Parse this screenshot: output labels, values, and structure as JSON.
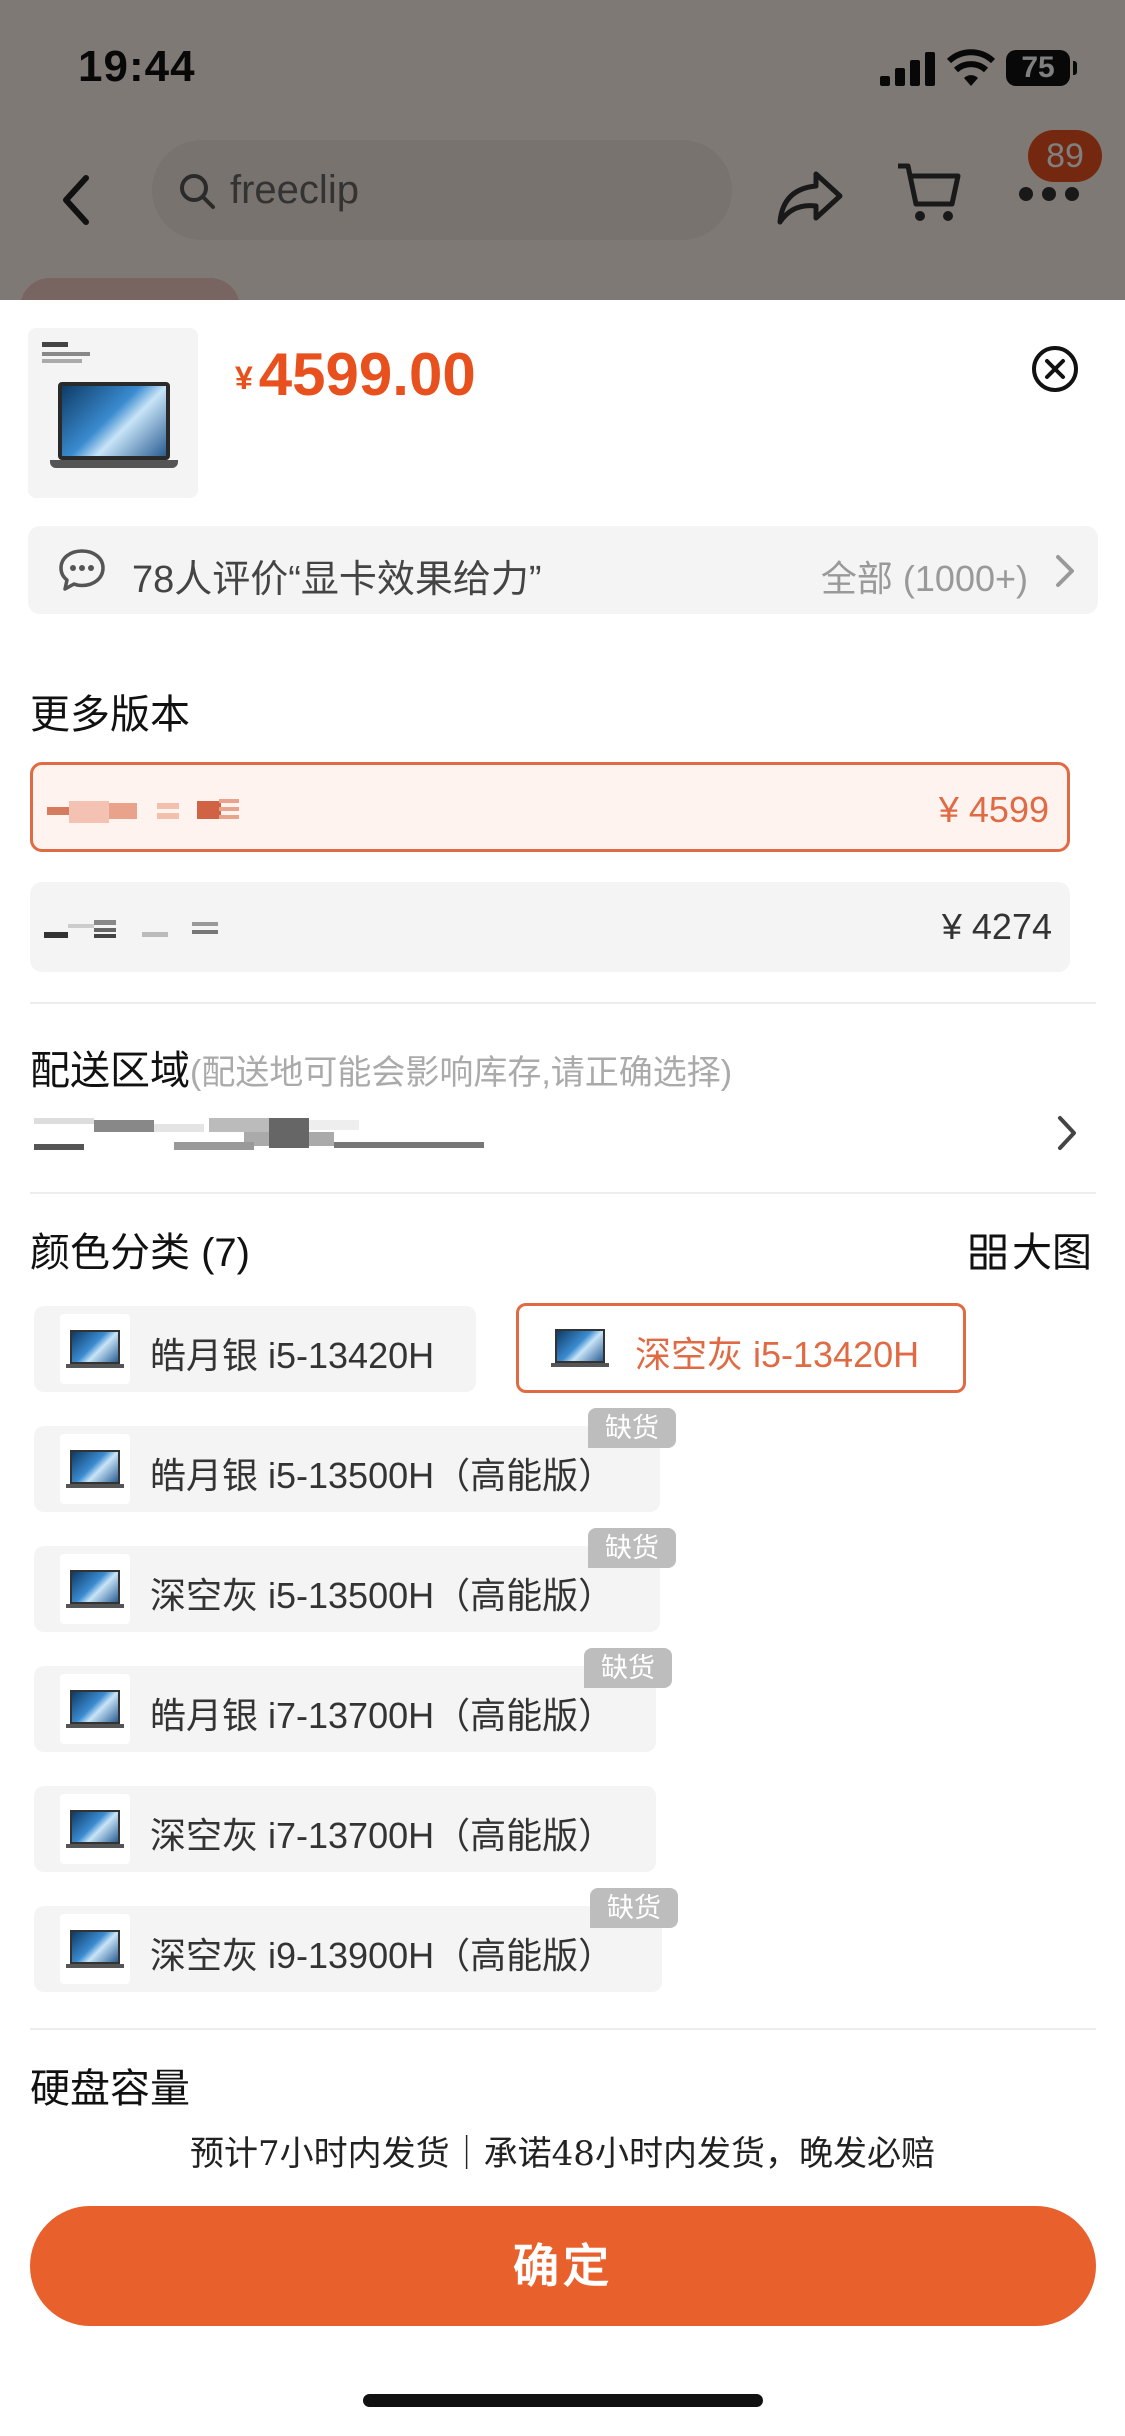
{
  "status_bar": {
    "time": "19:44",
    "battery": "75"
  },
  "nav": {
    "search_text": "freeclip",
    "cart_badge": "89"
  },
  "product": {
    "currency": "¥",
    "price": "4599.00"
  },
  "review": {
    "summary": "78人评价“显卡效果给力”",
    "all_label": "全部 (1000+)"
  },
  "versions": {
    "title": "更多版本",
    "items": [
      {
        "price": "¥ 4599",
        "selected": true
      },
      {
        "price": "¥ 4274",
        "selected": false
      }
    ]
  },
  "delivery": {
    "title": "配送区域",
    "note": "(配送地可能会影响库存,请正确选择)"
  },
  "colors": {
    "title": "颜色分类 (7)",
    "big_image_label": "大图",
    "out_of_stock_label": "缺货",
    "items": [
      {
        "label": "皓月银 i5-13420H",
        "selected": false,
        "out_of_stock": false
      },
      {
        "label": "深空灰 i5-13420H",
        "selected": true,
        "out_of_stock": false
      },
      {
        "label": "皓月银 i5-13500H（高能版）",
        "selected": false,
        "out_of_stock": true
      },
      {
        "label": "深空灰 i5-13500H（高能版）",
        "selected": false,
        "out_of_stock": true
      },
      {
        "label": "皓月银 i7-13700H（高能版）",
        "selected": false,
        "out_of_stock": true
      },
      {
        "label": "深空灰 i7-13700H（高能版）",
        "selected": false,
        "out_of_stock": false
      },
      {
        "label": "深空灰 i9-13900H（高能版）",
        "selected": false,
        "out_of_stock": true
      }
    ]
  },
  "storage": {
    "title": "硬盘容量"
  },
  "shipping_note": "预计7小时内发货｜承诺48小时内发货，晚发必赔",
  "confirm_label": "确定",
  "colors_theme": {
    "accent": "#e8602c",
    "selected_border": "#e06a43"
  }
}
